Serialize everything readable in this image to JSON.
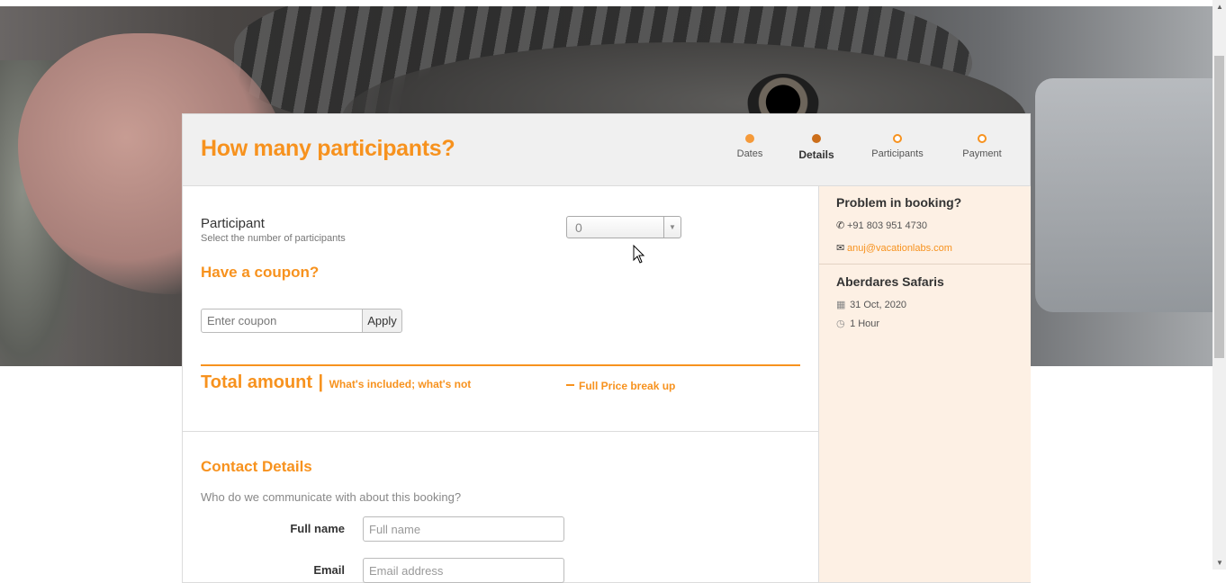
{
  "page": {
    "title": "How many participants?"
  },
  "steps": [
    {
      "label": "Dates",
      "state": "done"
    },
    {
      "label": "Details",
      "state": "active"
    },
    {
      "label": "Participants",
      "state": "todo"
    },
    {
      "label": "Payment",
      "state": "todo"
    }
  ],
  "participants": {
    "label": "Participant",
    "hint": "Select the number of participants",
    "selected": "0"
  },
  "coupon": {
    "title": "Have a coupon?",
    "placeholder": "Enter coupon",
    "apply_label": "Apply"
  },
  "total": {
    "title": "Total amount",
    "separator": "|",
    "included_link": "What's included; what's not",
    "breakup_link": "Full Price break up"
  },
  "contact": {
    "title": "Contact Details",
    "subtitle": "Who do we communicate with about this booking?",
    "full_name_label": "Full name",
    "full_name_placeholder": "Full name",
    "email_label": "Email",
    "email_placeholder": "Email address"
  },
  "sidebar": {
    "help_title": "Problem in booking?",
    "phone": "+91 803 951 4730",
    "email": "anuj@vacationlabs.com",
    "activity_title": "Aberdares Safaris",
    "date": "31 Oct, 2020",
    "duration": "1 Hour"
  },
  "colors": {
    "accent": "#f7921e",
    "sidebar_bg": "#fdf0e4",
    "header_bg": "#f0f0f0"
  }
}
